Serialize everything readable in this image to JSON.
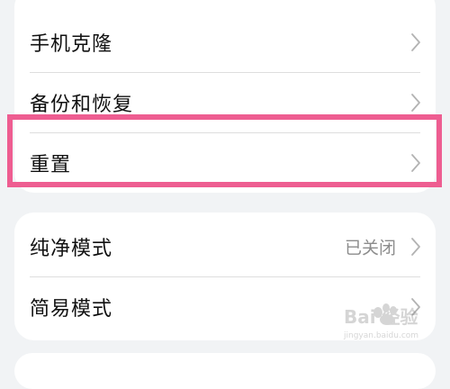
{
  "card1": {
    "items": [
      {
        "label": "手机克隆"
      },
      {
        "label": "备份和恢复"
      },
      {
        "label": "重置"
      }
    ]
  },
  "card2": {
    "items": [
      {
        "label": "纯净模式",
        "value": "已关闭"
      },
      {
        "label": "简易模式"
      }
    ]
  },
  "watermark": {
    "text": "Bai 经验",
    "url": "jingyan.baidu.com"
  },
  "colors": {
    "highlight": "#ee5d91",
    "background": "#f1f3f5",
    "card": "#ffffff",
    "chevron": "#b3b3b3"
  }
}
